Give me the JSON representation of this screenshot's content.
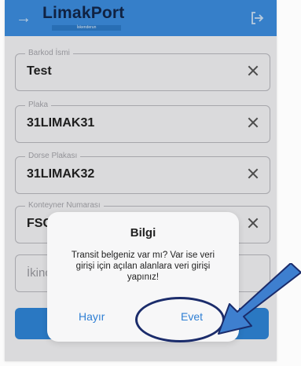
{
  "header": {
    "logo_text": "LimakPort",
    "logo_subtitle": "İskenderun",
    "back_icon": "arrow-right-icon",
    "logout_icon": "logout-icon"
  },
  "form": {
    "fields": [
      {
        "label": "Barkod İsmi",
        "value": "Test"
      },
      {
        "label": "Plaka",
        "value": "31LIMAK31"
      },
      {
        "label": "Dorse Plakası",
        "value": "31LIMAK32"
      },
      {
        "label": "Konteyner Numarası",
        "value": "FSC"
      },
      {
        "label": "",
        "placeholder": "İkinc"
      }
    ]
  },
  "dialog": {
    "title": "Bilgi",
    "message": "Transit belgeniz var mı? Var ise veri girişi için açılan alanlara veri girişi yapınız!",
    "no_label": "Hayır",
    "yes_label": "Evet"
  },
  "colors": {
    "header": "#3d8ee0",
    "accent": "#2f7fd4",
    "annotation": "#1b2c6b",
    "arrow": "#3e7fcf"
  }
}
